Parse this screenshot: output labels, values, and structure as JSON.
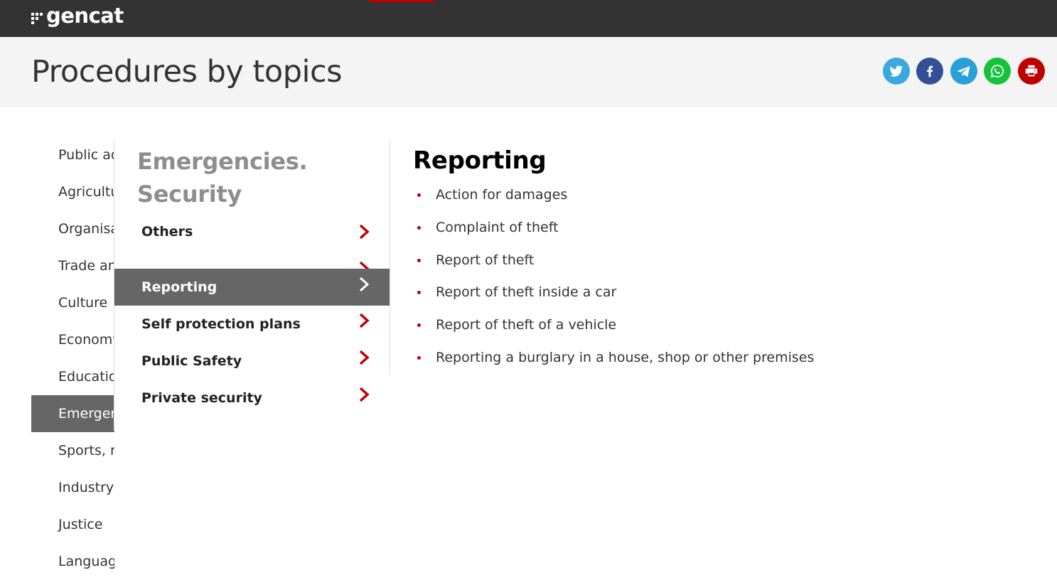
{
  "brand": {
    "name": "gencat"
  },
  "page": {
    "title": "Procedures by topics"
  },
  "share": [
    {
      "icon": "twitter-icon",
      "label": "Twitter",
      "color": "#39a9e0"
    },
    {
      "icon": "facebook-icon",
      "label": "Facebook",
      "color": "#324f97"
    },
    {
      "icon": "telegram-icon",
      "label": "Telegram",
      "color": "#2aa0d8"
    },
    {
      "icon": "whatsapp-icon",
      "label": "WhatsApp",
      "color": "#16c13c"
    },
    {
      "icon": "print-icon",
      "label": "Print",
      "color": "#c00000"
    }
  ],
  "left_nav": {
    "items": [
      {
        "label": "Public administration"
      },
      {
        "label": "Agriculture"
      },
      {
        "label": "Organisations"
      },
      {
        "label": "Trade and consumption"
      },
      {
        "label": "Culture"
      },
      {
        "label": "Economy"
      },
      {
        "label": "Education"
      },
      {
        "label": "Emergencies. Security",
        "active": true
      },
      {
        "label": "Sports, recreation"
      },
      {
        "label": "Industry"
      },
      {
        "label": "Justice"
      },
      {
        "label": "Language"
      }
    ]
  },
  "submenu": {
    "title_line1": "Emergencies.",
    "title_line2": "Security",
    "items": [
      {
        "label": "Others"
      },
      {
        "label": ""
      },
      {
        "label": "Reporting",
        "active": true
      },
      {
        "label": "Self protection plans"
      },
      {
        "label": "Public Safety"
      },
      {
        "label": "Private security"
      }
    ]
  },
  "content": {
    "heading": "Reporting",
    "items": [
      "Action for damages",
      "Complaint of theft",
      "Report of theft",
      "Report of theft inside a car",
      "Report of theft of a vehicle",
      "Reporting a burglary in a house, shop or other premises"
    ]
  },
  "colors": {
    "topbar": "#333333",
    "accent": "#c00000",
    "active_bg": "#666666",
    "header_band": "#f4f4f4"
  }
}
